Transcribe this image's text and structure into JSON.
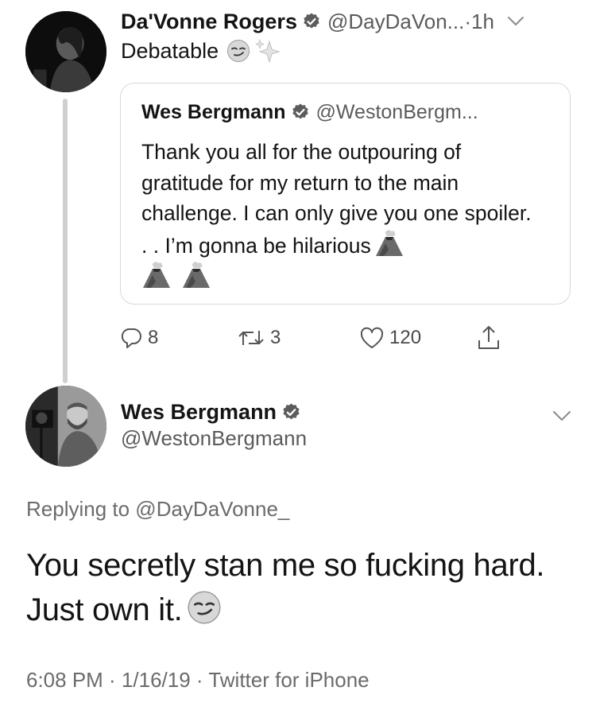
{
  "thread": {
    "tweet": {
      "author_name": "Da'Vonne Rogers",
      "handle_truncated": "@DayDaVon...",
      "time_sep": " · ",
      "time": "1h",
      "text": "Debatable",
      "emojis": [
        "smirk-emoji",
        "sparkles-emoji"
      ]
    },
    "quoted": {
      "author_name": "Wes Bergmann",
      "handle_truncated": "@WestonBergm...",
      "text": "Thank you all for the outpouring of gratitude for my return to the main challenge. I can only give you one spoiler. . . I’m gonna be hilarious",
      "emojis": [
        "volcano-emoji",
        "volcano-emoji",
        "volcano-emoji"
      ]
    },
    "actions": {
      "reply_count": "8",
      "retweet_count": "3",
      "like_count": "120"
    }
  },
  "focused": {
    "author_name": "Wes Bergmann",
    "handle": "@WestonBergmann",
    "replying_to": "Replying to @DayDaVonne_",
    "text": "You secretly stan me so fucking hard. Just own it.",
    "emoji": "smirk-emoji",
    "time": "6:08 PM",
    "date": "1/16/19",
    "source": "Twitter for iPhone",
    "sep": " · "
  },
  "colors": {
    "text": "#141414",
    "muted": "#5b5b5b",
    "border": "#d9d9d9",
    "thread_line": "#cfcfcf"
  }
}
